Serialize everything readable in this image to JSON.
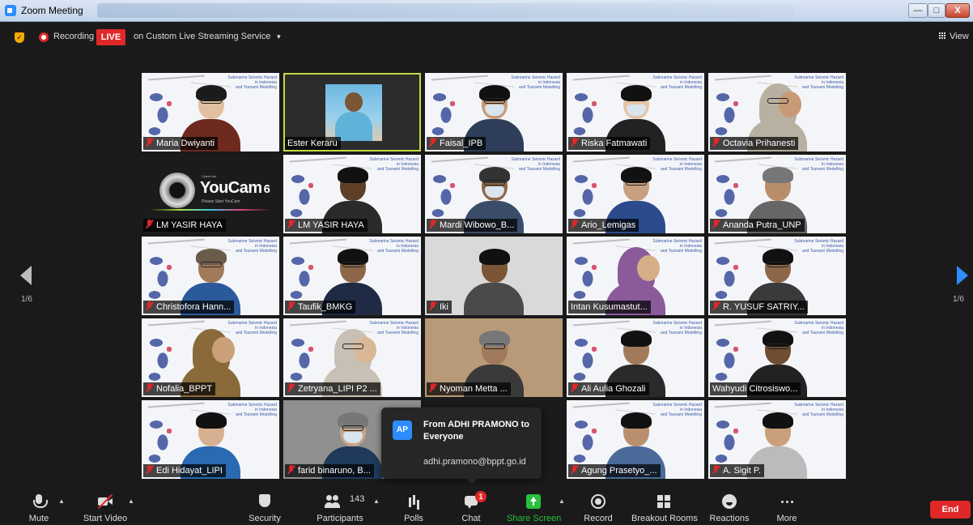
{
  "window": {
    "title": "Zoom Meeting",
    "min_label": "—",
    "max_label": "□",
    "close_label": "X"
  },
  "status": {
    "recording_label": "Recording",
    "live_badge": "LIVE",
    "live_service": "on Custom Live Streaming Service",
    "view_label": "View"
  },
  "pager": {
    "left_label": "1/6",
    "right_label": "1/6"
  },
  "slide_text": "Submarine Seismic Hazard\nin Indonesia\nand Tsunami Modelling",
  "youcam": {
    "brand": "CyberLink",
    "name": "YouCam",
    "version": "6",
    "subtitle": "Please Start YouCam"
  },
  "participants": [
    {
      "name": "Maria Dwiyanti",
      "muted": true
    },
    {
      "name": "Ester Keraru",
      "muted": false
    },
    {
      "name": "Faisal_IPB",
      "muted": true
    },
    {
      "name": "Riska Fatmawati",
      "muted": true
    },
    {
      "name": "Octavia Prihanesti",
      "muted": true
    },
    {
      "name": "LM YASIR HAYA",
      "muted": true
    },
    {
      "name": "LM YASIR HAYA",
      "muted": true
    },
    {
      "name": "Mardi Wibowo_B...",
      "muted": true
    },
    {
      "name": "Ario_Lemigas",
      "muted": true
    },
    {
      "name": "Ananda Putra_UNP",
      "muted": true
    },
    {
      "name": "Christofora Hann...",
      "muted": true
    },
    {
      "name": "Taufik_BMKG",
      "muted": true
    },
    {
      "name": "Iki",
      "muted": true
    },
    {
      "name": "Intan Kusumastut...",
      "muted": false
    },
    {
      "name": "R. YUSUF SATRIY...",
      "muted": true
    },
    {
      "name": "Nofalia_BPPT",
      "muted": true
    },
    {
      "name": "Zetryana_LIPI P2 ...",
      "muted": true
    },
    {
      "name": "Nyoman Metta ...",
      "muted": true
    },
    {
      "name": "Ali Aulia Ghozali",
      "muted": true
    },
    {
      "name": "Wahyudi Citrosiswo...",
      "muted": false
    },
    {
      "name": "Edi Hidayat_LIPI",
      "muted": true
    },
    {
      "name": "farid binaruno, B...",
      "muted": true
    },
    {
      "name": "",
      "muted": false
    },
    {
      "name": "Agung Prasetyo_...",
      "muted": true
    },
    {
      "name": "A. Sigit P.",
      "muted": true
    }
  ],
  "chat_popup": {
    "avatar_initials": "AP",
    "sender": "From ADHI PRAMONO to Everyone",
    "message": "adhi.pramono@bppt.go.id"
  },
  "toolbar": {
    "mute": "Mute",
    "start_video": "Start Video",
    "security": "Security",
    "participants": "Participants",
    "participant_count": "143",
    "polls": "Polls",
    "chat": "Chat",
    "chat_badge": "1",
    "share_screen": "Share Screen",
    "record": "Record",
    "breakout_rooms": "Breakout Rooms",
    "reactions": "Reactions",
    "more": "More",
    "end": "End"
  },
  "colors": {
    "accent": "#2d8cff",
    "live_red": "#e02828",
    "share_green": "#27c13c",
    "speaker_outline": "#c6d940"
  }
}
